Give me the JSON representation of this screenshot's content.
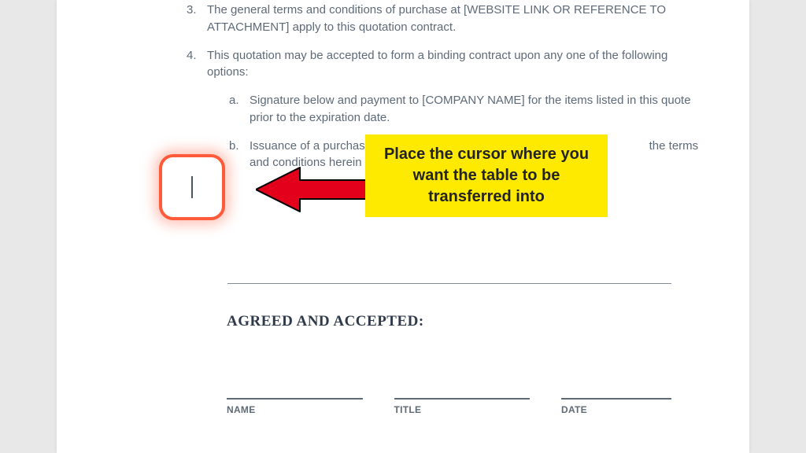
{
  "list": {
    "item3": {
      "marker": "3.",
      "text": "The general terms and conditions of purchase at [WEBSITE LINK OR REFERENCE TO ATTACHMENT] apply to this quotation contract."
    },
    "item4": {
      "marker": "4.",
      "text": "This quotation may be accepted to form a binding contract upon any one of the following options:",
      "sub": {
        "a": {
          "marker": "a.",
          "text": "Signature below and payment to [COMPANY NAME] for the items listed in this quote prior to the expiration date."
        },
        "b": {
          "marker": "b.",
          "text_left": "Issuance of a purchase orde",
          "text_right": " the terms and conditions herein prior t"
        }
      }
    }
  },
  "callout": {
    "text": "Place the cursor where you want the table to be transferred into"
  },
  "agreed": {
    "heading": "AGREED AND ACCEPTED:",
    "name_label": "NAME",
    "title_label": "TITLE",
    "date_label": "DATE"
  }
}
